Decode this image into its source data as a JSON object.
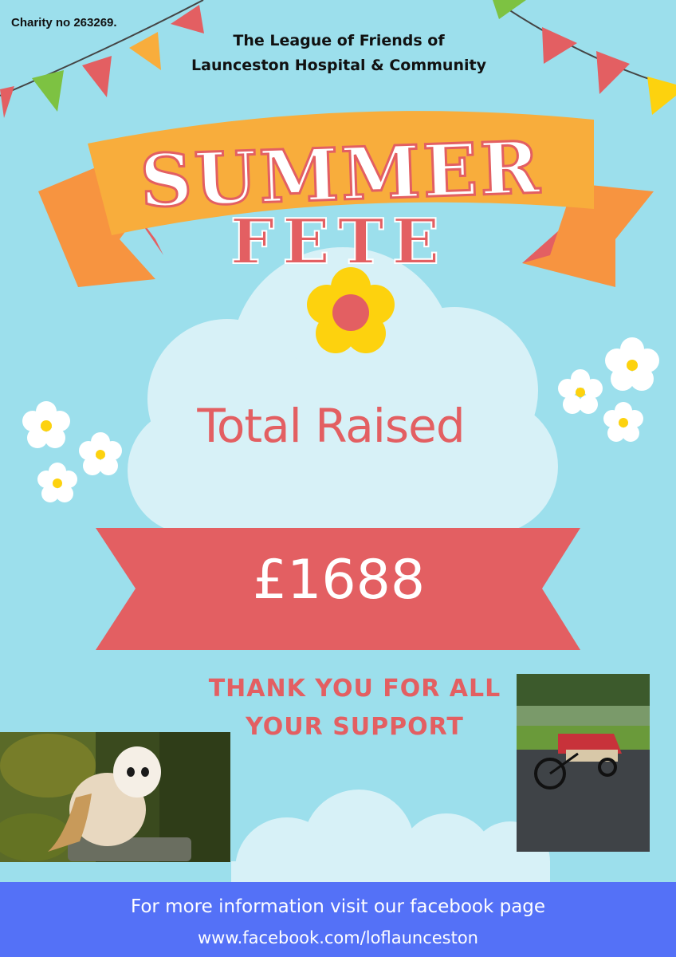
{
  "charity_number": "Charity no 263269.",
  "organisation": {
    "line1": "The League of Friends of",
    "line2": "Launceston Hospital & Community"
  },
  "banner": {
    "title": "SUMMER",
    "subtitle": "FETE"
  },
  "fundraising": {
    "heading": "Total Raised",
    "amount": "£1688"
  },
  "thanks": {
    "line1": "THANK YOU FOR ALL",
    "line2": "YOUR SUPPORT"
  },
  "footer": {
    "info": "For more information visit our facebook page",
    "url": "www.facebook.com/loflaunceston"
  },
  "colors": {
    "background": "#9cdfec",
    "banner_orange": "#f8ad3c",
    "ribbon_red": "#e35f62",
    "footer_blue": "#5471f7",
    "flower_yellow": "#fdd20e",
    "cloud": "#d7f1f7"
  },
  "images": {
    "left": "barn-owl-photo",
    "right": "bicycle-rickshaw-photo"
  }
}
